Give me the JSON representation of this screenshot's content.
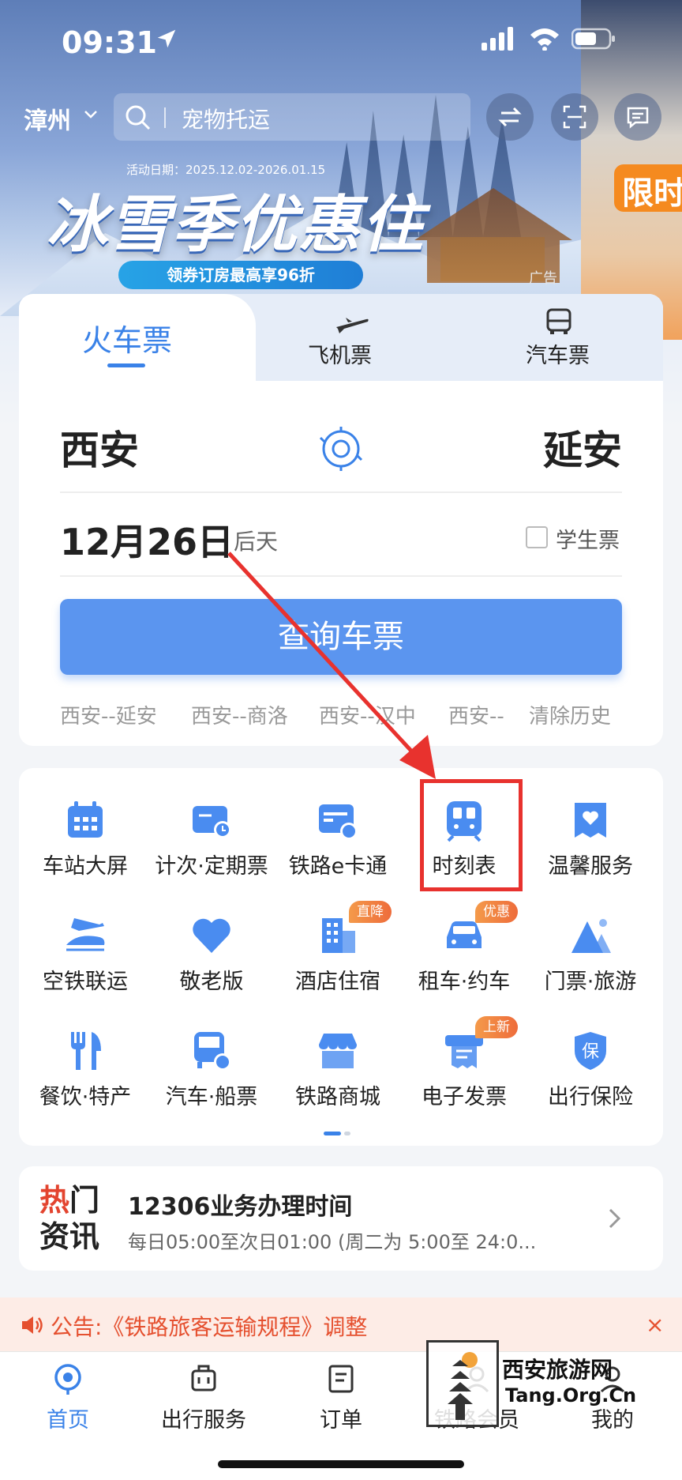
{
  "status_bar": {
    "time": "09:31"
  },
  "top_bar": {
    "city": "漳州",
    "search_placeholder": "宠物托运"
  },
  "promo": {
    "date": "活动日期：2025.12.02-2026.01.15",
    "title": "冰雪季优惠住",
    "pill": "领券订房最高享96折",
    "ad_label": "广告",
    "side_text": "限时"
  },
  "ticket_tabs": [
    {
      "label": "火车票",
      "active": true
    },
    {
      "label": "飞机票",
      "icon": "plane-icon"
    },
    {
      "label": "汽车票",
      "icon": "bus-icon"
    }
  ],
  "route": {
    "from": "西安",
    "to": "延安"
  },
  "date": {
    "value": "12月26日",
    "relative": "后天"
  },
  "student_ticket": "学生票",
  "query_button": "查询车票",
  "history": [
    "西安--延安",
    "西安--商洛",
    "西安--汉中",
    "西安--",
    "清除历史"
  ],
  "services": [
    {
      "label": "车站大屏",
      "icon": "calendar-screen-icon"
    },
    {
      "label": "计次·定期票",
      "icon": "ticket-card-icon"
    },
    {
      "label": "铁路e卡通",
      "icon": "ecard-icon"
    },
    {
      "label": "时刻表",
      "icon": "train-schedule-icon"
    },
    {
      "label": "温馨服务",
      "icon": "heart-service-icon"
    },
    {
      "label": "空铁联运",
      "icon": "plane-train-icon"
    },
    {
      "label": "敬老版",
      "icon": "heart-icon"
    },
    {
      "label": "酒店住宿",
      "icon": "hotel-icon",
      "badge": "直降"
    },
    {
      "label": "租车·约车",
      "icon": "car-icon",
      "badge": "优惠"
    },
    {
      "label": "门票·旅游",
      "icon": "mountain-icon"
    },
    {
      "label": "餐饮·特产",
      "icon": "dining-icon"
    },
    {
      "label": "汽车·船票",
      "icon": "bus-ship-icon"
    },
    {
      "label": "铁路商城",
      "icon": "shop-icon"
    },
    {
      "label": "电子发票",
      "icon": "invoice-icon",
      "badge": "上新"
    },
    {
      "label": "出行保险",
      "icon": "shield-icon",
      "shield_char": "保"
    }
  ],
  "news": {
    "tag_line1_a": "热",
    "tag_line1_b": "门",
    "tag_line2": "资讯",
    "title": "12306业务办理时间",
    "subtitle": "每日05:00至次日01:00 (周二为 5:00至 24:0..."
  },
  "notice": {
    "text": "公告:《铁路旅客运输规程》调整",
    "close": "×"
  },
  "bottom_nav": [
    {
      "label": "首页",
      "active": true
    },
    {
      "label": "出行服务"
    },
    {
      "label": "订单"
    },
    {
      "label": "铁路会员"
    },
    {
      "label": "我的"
    }
  ],
  "watermark": {
    "line1": "西安旅游网",
    "line2": "Tang.Org.Cn"
  },
  "colors": {
    "accent": "#3a82e8",
    "button": "#5b95ef",
    "highlight": "#e8322e",
    "notice": "#e5502f"
  }
}
